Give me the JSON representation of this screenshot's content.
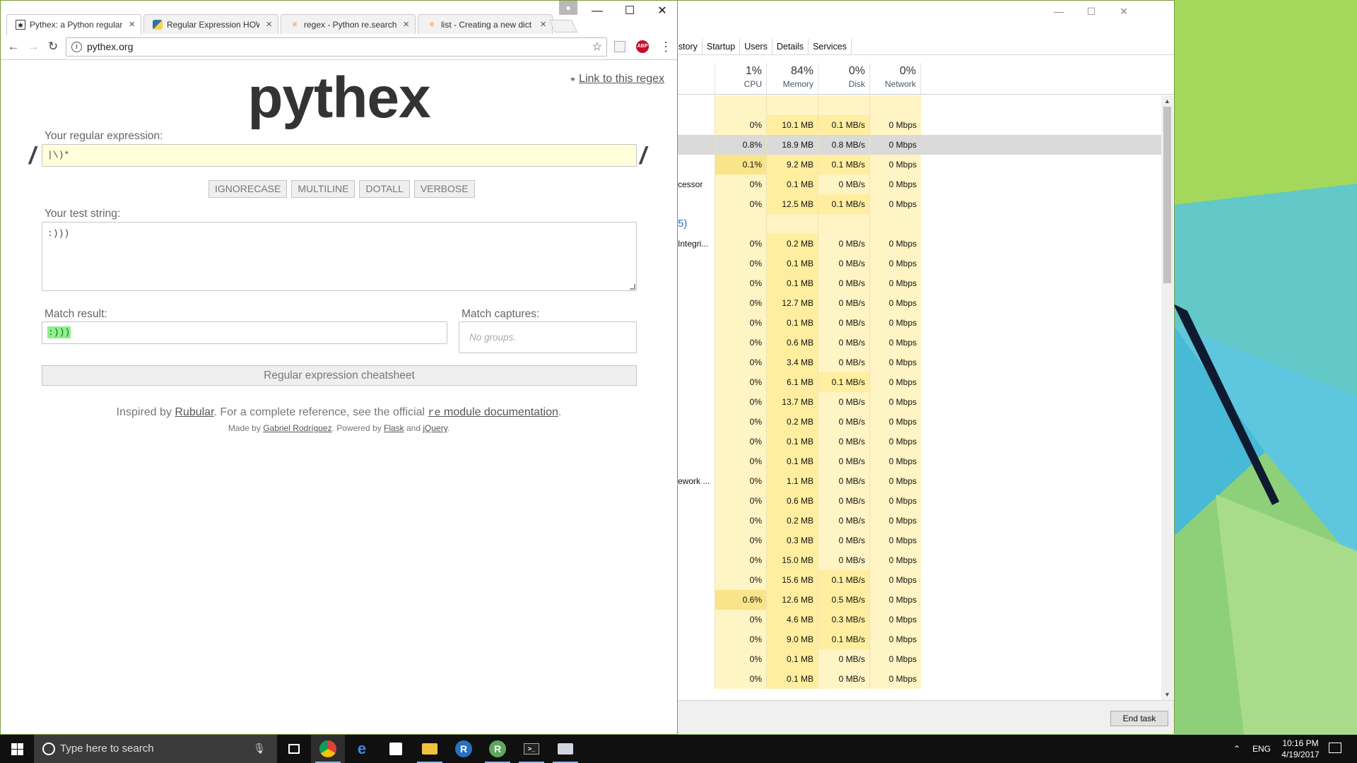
{
  "chrome": {
    "tabs": [
      {
        "title": "Pythex: a Python regular",
        "icon": "pythex-favicon",
        "active": true
      },
      {
        "title": "Regular Expression HOW",
        "icon": "python-favicon",
        "active": false
      },
      {
        "title": "regex - Python re.search",
        "icon": "stackoverflow-favicon",
        "active": false
      },
      {
        "title": "list - Creating a new dict",
        "icon": "stackoverflow-favicon",
        "active": false
      }
    ],
    "url": "pythex.org",
    "abp_label": "ABP"
  },
  "pythex": {
    "logo": "pythex",
    "permalink": "Link to this regex",
    "regex_label": "Your regular expression:",
    "regex_value": "|\\)*",
    "flags": [
      "IGNORECASE",
      "MULTILINE",
      "DOTALL",
      "VERBOSE"
    ],
    "test_label": "Your test string:",
    "test_value": ":)))",
    "result_label": "Match result:",
    "result_match": ":)))",
    "captures_label": "Match captures:",
    "captures_placeholder": "No groups.",
    "cheatsheet": "Regular expression cheatsheet",
    "footer": {
      "inspired_prefix": "Inspired by",
      "rubular": "Rubular",
      "mid": ". For a complete reference, see the official",
      "re_mod": "re",
      "doc": "module documentation",
      "end": ".",
      "made_by": "Made by",
      "author": "Gabriel Rodríguez",
      "powered": ". Powered by",
      "flask": "Flask",
      "and": "and",
      "jquery": "jQuery",
      "dot": "."
    }
  },
  "taskmanager": {
    "tabs": [
      "istory",
      "Startup",
      "Users",
      "Details",
      "Services"
    ],
    "columns": [
      {
        "pct": "1%",
        "label": "CPU"
      },
      {
        "pct": "84%",
        "label": "Memory"
      },
      {
        "pct": "0%",
        "label": "Disk"
      },
      {
        "pct": "0%",
        "label": "Network"
      }
    ],
    "rows": [
      {
        "name": "",
        "cpu": "",
        "mem": "",
        "disk": "",
        "net": ""
      },
      {
        "name": "",
        "cpu": "0%",
        "mem": "10.1 MB",
        "disk": "0.1 MB/s",
        "net": "0 Mbps"
      },
      {
        "name": "",
        "cpu": "0.8%",
        "mem": "18.9 MB",
        "disk": "0.8 MB/s",
        "net": "0 Mbps"
      },
      {
        "name": "",
        "cpu": "0.1%",
        "mem": "9.2 MB",
        "disk": "0.1 MB/s",
        "net": "0 Mbps"
      },
      {
        "name": "cessor",
        "cpu": "0%",
        "mem": "0.1 MB",
        "disk": "0 MB/s",
        "net": "0 Mbps"
      },
      {
        "name": "",
        "cpu": "0%",
        "mem": "12.5 MB",
        "disk": "0.1 MB/s",
        "net": "0 Mbps"
      },
      {
        "name": "5)",
        "cpu": "",
        "mem": "",
        "disk": "",
        "net": ""
      },
      {
        "name": "Integri...",
        "cpu": "0%",
        "mem": "0.2 MB",
        "disk": "0 MB/s",
        "net": "0 Mbps"
      },
      {
        "name": "",
        "cpu": "0%",
        "mem": "0.1 MB",
        "disk": "0 MB/s",
        "net": "0 Mbps"
      },
      {
        "name": "",
        "cpu": "0%",
        "mem": "0.1 MB",
        "disk": "0 MB/s",
        "net": "0 Mbps"
      },
      {
        "name": "",
        "cpu": "0%",
        "mem": "12.7 MB",
        "disk": "0 MB/s",
        "net": "0 Mbps"
      },
      {
        "name": "",
        "cpu": "0%",
        "mem": "0.1 MB",
        "disk": "0 MB/s",
        "net": "0 Mbps"
      },
      {
        "name": "",
        "cpu": "0%",
        "mem": "0.6 MB",
        "disk": "0 MB/s",
        "net": "0 Mbps"
      },
      {
        "name": "",
        "cpu": "0%",
        "mem": "3.4 MB",
        "disk": "0 MB/s",
        "net": "0 Mbps"
      },
      {
        "name": "",
        "cpu": "0%",
        "mem": "6.1 MB",
        "disk": "0.1 MB/s",
        "net": "0 Mbps"
      },
      {
        "name": "",
        "cpu": "0%",
        "mem": "13.7 MB",
        "disk": "0 MB/s",
        "net": "0 Mbps"
      },
      {
        "name": "",
        "cpu": "0%",
        "mem": "0.2 MB",
        "disk": "0 MB/s",
        "net": "0 Mbps"
      },
      {
        "name": "",
        "cpu": "0%",
        "mem": "0.1 MB",
        "disk": "0 MB/s",
        "net": "0 Mbps"
      },
      {
        "name": "",
        "cpu": "0%",
        "mem": "0.1 MB",
        "disk": "0 MB/s",
        "net": "0 Mbps"
      },
      {
        "name": "ework ...",
        "cpu": "0%",
        "mem": "1.1 MB",
        "disk": "0 MB/s",
        "net": "0 Mbps"
      },
      {
        "name": "",
        "cpu": "0%",
        "mem": "0.6 MB",
        "disk": "0 MB/s",
        "net": "0 Mbps"
      },
      {
        "name": "",
        "cpu": "0%",
        "mem": "0.2 MB",
        "disk": "0 MB/s",
        "net": "0 Mbps"
      },
      {
        "name": "",
        "cpu": "0%",
        "mem": "0.3 MB",
        "disk": "0 MB/s",
        "net": "0 Mbps"
      },
      {
        "name": "",
        "cpu": "0%",
        "mem": "15.0 MB",
        "disk": "0 MB/s",
        "net": "0 Mbps"
      },
      {
        "name": "",
        "cpu": "0%",
        "mem": "15.6 MB",
        "disk": "0.1 MB/s",
        "net": "0 Mbps"
      },
      {
        "name": "",
        "cpu": "0.6%",
        "mem": "12.6 MB",
        "disk": "0.5 MB/s",
        "net": "0 Mbps"
      },
      {
        "name": "",
        "cpu": "0%",
        "mem": "4.6 MB",
        "disk": "0.3 MB/s",
        "net": "0 Mbps"
      },
      {
        "name": "",
        "cpu": "0%",
        "mem": "9.0 MB",
        "disk": "0.1 MB/s",
        "net": "0 Mbps"
      },
      {
        "name": "",
        "cpu": "0%",
        "mem": "0.1 MB",
        "disk": "0 MB/s",
        "net": "0 Mbps"
      },
      {
        "name": "",
        "cpu": "0%",
        "mem": "0.1 MB",
        "disk": "0 MB/s",
        "net": "0 Mbps"
      }
    ],
    "end_task": "End task",
    "colors": {
      "heat_light": "#fff4c4",
      "heat_mid": "#ffeea0",
      "heat_strong": "#f9e48a",
      "selected": "#dadada"
    }
  },
  "taskbar": {
    "search_placeholder": "Type here to search",
    "apps": [
      "task-view",
      "chrome",
      "edge",
      "store",
      "file-explorer",
      "r",
      "rstudio",
      "cmd",
      "remote-desktop"
    ],
    "lang": "ENG",
    "time": "10:16 PM",
    "date": "4/19/2017"
  }
}
